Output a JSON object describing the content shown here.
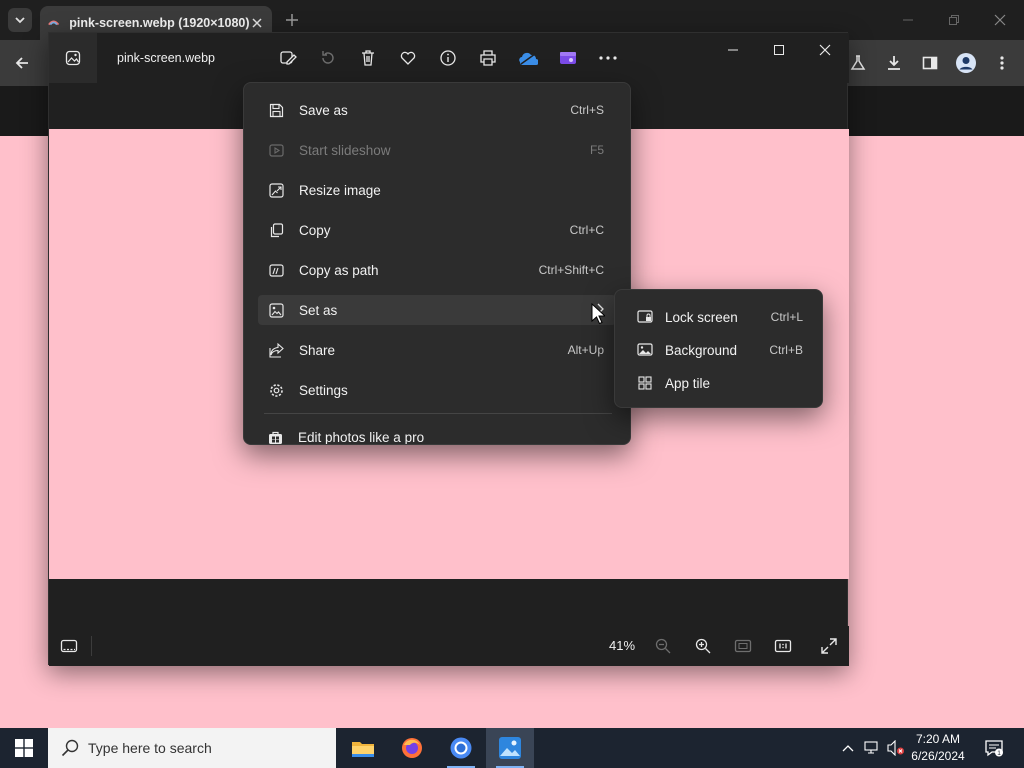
{
  "colors": {
    "pink_background": "#ffc0cb",
    "photos_bg": "#202020",
    "menu_bg": "#2c2c2c",
    "taskbar_bg": "#1c2430",
    "accent": "#7fb3f5"
  },
  "browser": {
    "tab_title": "pink-screen.webp (1920×1080)",
    "tab_favicon": "tab-favicon-icon",
    "toolbar_icons": [
      "back-icon",
      "labs-flask-icon",
      "download-icon",
      "sidebar-icon",
      "profile-icon",
      "more-vert-icon"
    ]
  },
  "photos": {
    "file_name": "pink-screen.webp",
    "title_tools": [
      "edit-image-icon",
      "rotate-icon",
      "delete-icon",
      "favorite-icon",
      "info-icon",
      "print-icon",
      "onedrive-icon",
      "clipchamp-icon",
      "more-options-icon"
    ],
    "zoom_level": "41%"
  },
  "context_menu": {
    "items": [
      {
        "label": "Save as",
        "shortcut": "Ctrl+S",
        "icon": "save-icon",
        "disabled": false
      },
      {
        "label": "Start slideshow",
        "shortcut": "F5",
        "icon": "slideshow-icon",
        "disabled": true
      },
      {
        "label": "Resize image",
        "shortcut": "",
        "icon": "resize-icon",
        "disabled": false
      },
      {
        "label": "Copy",
        "shortcut": "Ctrl+C",
        "icon": "copy-icon",
        "disabled": false
      },
      {
        "label": "Copy as path",
        "shortcut": "Ctrl+Shift+C",
        "icon": "copy-path-icon",
        "disabled": false
      },
      {
        "label": "Set as",
        "shortcut": "",
        "icon": "set-as-icon",
        "disabled": false,
        "has_submenu": true,
        "highlighted": true
      },
      {
        "label": "Share",
        "shortcut": "Alt+Up",
        "icon": "share-icon",
        "disabled": false
      },
      {
        "label": "Settings",
        "shortcut": "",
        "icon": "settings-icon",
        "disabled": false
      }
    ],
    "footer": {
      "label": "Edit photos like a pro",
      "icon": "store-icon"
    }
  },
  "submenu": {
    "items": [
      {
        "label": "Lock screen",
        "shortcut": "Ctrl+L",
        "icon": "lock-screen-icon"
      },
      {
        "label": "Background",
        "shortcut": "Ctrl+B",
        "icon": "background-icon"
      },
      {
        "label": "App tile",
        "shortcut": "",
        "icon": "app-tile-icon"
      }
    ]
  },
  "taskbar": {
    "search_placeholder": "Type here to search",
    "apps": [
      "file-explorer-icon",
      "firefox-icon",
      "chrome-icon",
      "photos-app-icon"
    ],
    "time": "7:20 AM",
    "date": "6/26/2024",
    "notification_count": "1"
  }
}
